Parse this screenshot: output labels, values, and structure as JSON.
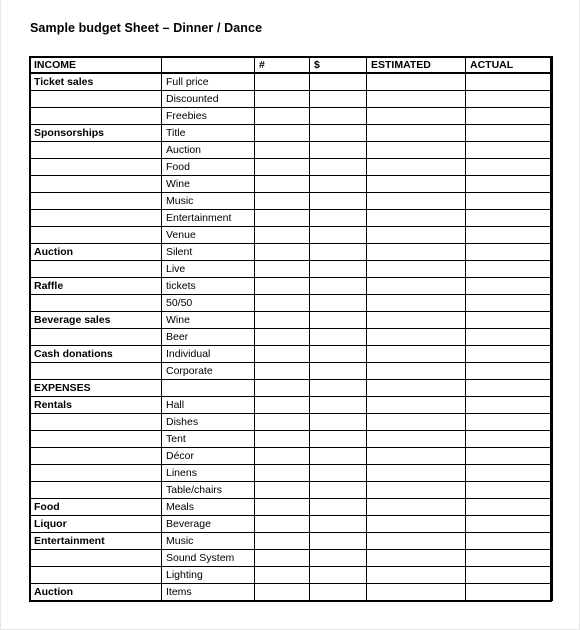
{
  "document": {
    "title": "Sample budget Sheet – Dinner / Dance",
    "page_background": "#ffffff",
    "text_color": "#000000",
    "border_color": "#000000"
  },
  "table": {
    "columns": [
      {
        "key": "category",
        "label": "INCOME"
      },
      {
        "key": "item",
        "label": ""
      },
      {
        "key": "number",
        "label": "#"
      },
      {
        "key": "dollar",
        "label": "$"
      },
      {
        "key": "estimated",
        "label": "ESTIMATED"
      },
      {
        "key": "actual",
        "label": "ACTUAL"
      }
    ],
    "rows": [
      {
        "category": "Ticket sales",
        "item": "Full price",
        "number": "",
        "dollar": "",
        "estimated": "",
        "actual": ""
      },
      {
        "category": "",
        "item": "Discounted",
        "number": "",
        "dollar": "",
        "estimated": "",
        "actual": ""
      },
      {
        "category": "",
        "item": "Freebies",
        "number": "",
        "dollar": "",
        "estimated": "",
        "actual": ""
      },
      {
        "category": "Sponsorships",
        "item": "Title",
        "number": "",
        "dollar": "",
        "estimated": "",
        "actual": ""
      },
      {
        "category": "",
        "item": "Auction",
        "number": "",
        "dollar": "",
        "estimated": "",
        "actual": ""
      },
      {
        "category": "",
        "item": "Food",
        "number": "",
        "dollar": "",
        "estimated": "",
        "actual": ""
      },
      {
        "category": "",
        "item": "Wine",
        "number": "",
        "dollar": "",
        "estimated": "",
        "actual": ""
      },
      {
        "category": "",
        "item": "Music",
        "number": "",
        "dollar": "",
        "estimated": "",
        "actual": ""
      },
      {
        "category": "",
        "item": "Entertainment",
        "number": "",
        "dollar": "",
        "estimated": "",
        "actual": ""
      },
      {
        "category": "",
        "item": "Venue",
        "number": "",
        "dollar": "",
        "estimated": "",
        "actual": ""
      },
      {
        "category": "Auction",
        "item": "Silent",
        "number": "",
        "dollar": "",
        "estimated": "",
        "actual": ""
      },
      {
        "category": "",
        "item": "Live",
        "number": "",
        "dollar": "",
        "estimated": "",
        "actual": ""
      },
      {
        "category": "Raffle",
        "item": "tickets",
        "number": "",
        "dollar": "",
        "estimated": "",
        "actual": ""
      },
      {
        "category": "",
        "item": "50/50",
        "number": "",
        "dollar": "",
        "estimated": "",
        "actual": ""
      },
      {
        "category": "Beverage sales",
        "item": "Wine",
        "number": "",
        "dollar": "",
        "estimated": "",
        "actual": ""
      },
      {
        "category": "",
        "item": "Beer",
        "number": "",
        "dollar": "",
        "estimated": "",
        "actual": ""
      },
      {
        "category": "Cash donations",
        "item": "Individual",
        "number": "",
        "dollar": "",
        "estimated": "",
        "actual": ""
      },
      {
        "category": "",
        "item": "Corporate",
        "number": "",
        "dollar": "",
        "estimated": "",
        "actual": ""
      },
      {
        "category": "EXPENSES",
        "item": "",
        "number": "",
        "dollar": "",
        "estimated": "",
        "actual": ""
      },
      {
        "category": "Rentals",
        "item": "Hall",
        "number": "",
        "dollar": "",
        "estimated": "",
        "actual": ""
      },
      {
        "category": "",
        "item": "Dishes",
        "number": "",
        "dollar": "",
        "estimated": "",
        "actual": ""
      },
      {
        "category": "",
        "item": "Tent",
        "number": "",
        "dollar": "",
        "estimated": "",
        "actual": ""
      },
      {
        "category": "",
        "item": "Décor",
        "number": "",
        "dollar": "",
        "estimated": "",
        "actual": ""
      },
      {
        "category": "",
        "item": "Linens",
        "number": "",
        "dollar": "",
        "estimated": "",
        "actual": ""
      },
      {
        "category": "",
        "item": "Table/chairs",
        "number": "",
        "dollar": "",
        "estimated": "",
        "actual": ""
      },
      {
        "category": "Food",
        "item": "Meals",
        "number": "",
        "dollar": "",
        "estimated": "",
        "actual": ""
      },
      {
        "category": "Liquor",
        "item": "Beverage",
        "number": "",
        "dollar": "",
        "estimated": "",
        "actual": ""
      },
      {
        "category": "Entertainment",
        "item": "Music",
        "number": "",
        "dollar": "",
        "estimated": "",
        "actual": ""
      },
      {
        "category": "",
        "item": "Sound System",
        "number": "",
        "dollar": "",
        "estimated": "",
        "actual": ""
      },
      {
        "category": "",
        "item": "Lighting",
        "number": "",
        "dollar": "",
        "estimated": "",
        "actual": ""
      },
      {
        "category": "Auction",
        "item": "Items",
        "number": "",
        "dollar": "",
        "estimated": "",
        "actual": ""
      }
    ]
  }
}
